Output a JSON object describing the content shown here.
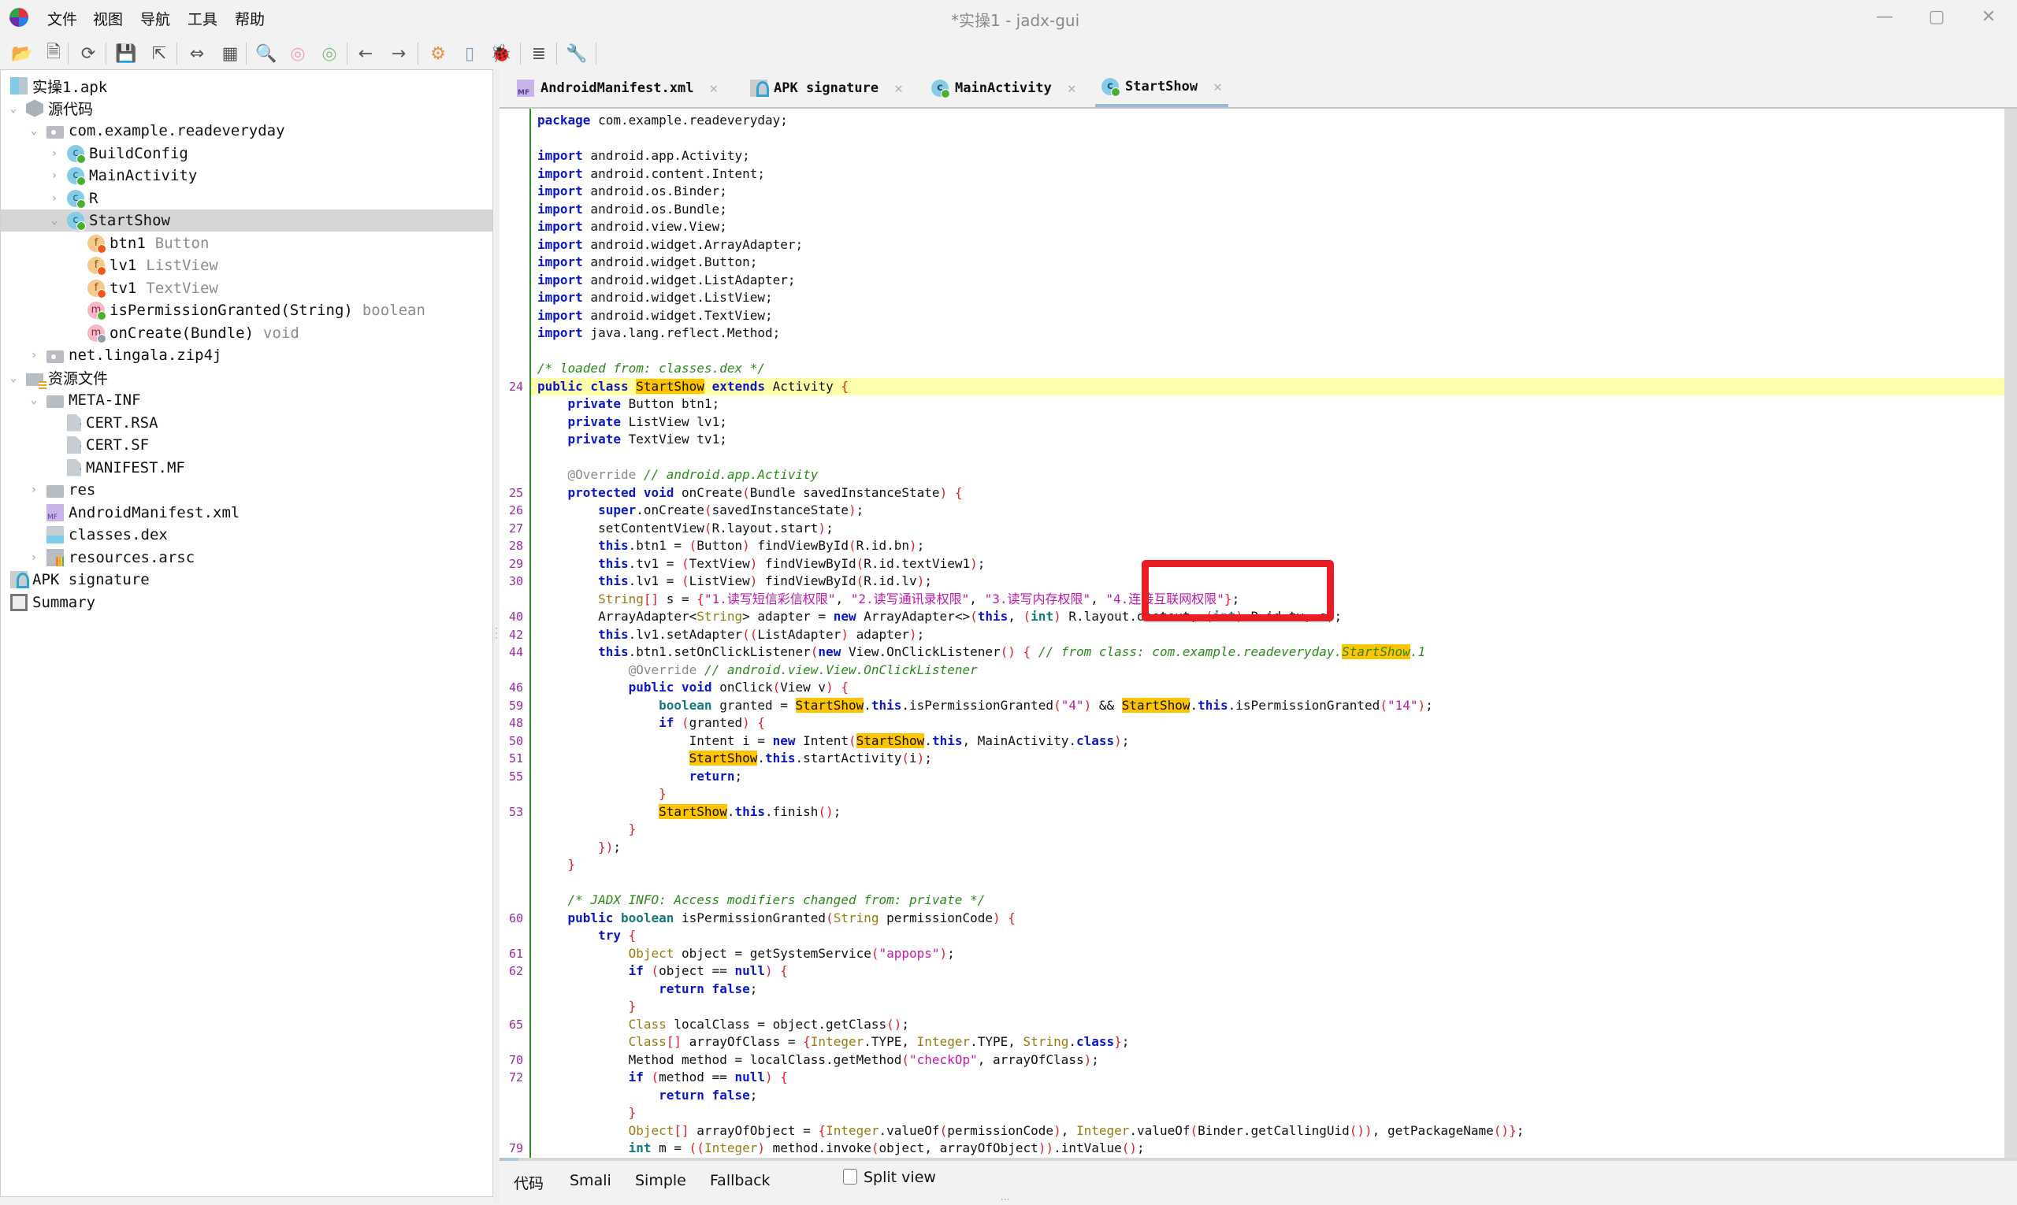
{
  "window": {
    "title": "*实操1 - jadx-gui",
    "controls": {
      "minimize": "—",
      "maximize": "▢",
      "close": "✕"
    }
  },
  "menu": [
    "文件",
    "视图",
    "导航",
    "工具",
    "帮助"
  ],
  "toolbar": {
    "buttons": [
      {
        "name": "open-file",
        "glyph": "📂"
      },
      {
        "name": "add-files",
        "glyph": "🗎"
      },
      {
        "name": "sync",
        "glyph": "⟳"
      },
      {
        "name": "save-all",
        "glyph": "💾"
      },
      {
        "name": "export",
        "glyph": "⇱"
      },
      {
        "name": "flatten-packages",
        "glyph": "⇔"
      },
      {
        "name": "sync-tree",
        "glyph": "▦"
      },
      {
        "name": "search-text",
        "glyph": "🔍"
      },
      {
        "name": "search-class",
        "glyph": "◎"
      },
      {
        "name": "search-usage",
        "glyph": "◎"
      },
      {
        "name": "back",
        "glyph": "←"
      },
      {
        "name": "forward",
        "glyph": "→"
      },
      {
        "name": "deobfuscation",
        "glyph": "⚙"
      },
      {
        "name": "smali-view",
        "glyph": "▯"
      },
      {
        "name": "debugger",
        "glyph": "🐞"
      },
      {
        "name": "log-viewer",
        "glyph": "≣"
      },
      {
        "name": "preferences",
        "glyph": "🔧"
      }
    ]
  },
  "tree": {
    "items": [
      {
        "label": "实操1.apk",
        "icon": "apk",
        "depth": 0,
        "toggle": ""
      },
      {
        "label": "源代码",
        "icon": "cube",
        "depth": 0,
        "toggle": "⌄"
      },
      {
        "label": "com.example.readeveryday",
        "icon": "package",
        "depth": 1,
        "toggle": "⌄"
      },
      {
        "label": "BuildConfig",
        "icon": "class",
        "depth": 2,
        "toggle": "›"
      },
      {
        "label": "MainActivity",
        "icon": "class",
        "depth": 2,
        "toggle": "›"
      },
      {
        "label": "R",
        "icon": "class",
        "depth": 2,
        "toggle": "›"
      },
      {
        "label": "StartShow",
        "icon": "class",
        "depth": 2,
        "toggle": "⌄",
        "selected": true
      },
      {
        "label": "btn1",
        "type": "Button",
        "icon": "field",
        "depth": 3,
        "toggle": ""
      },
      {
        "label": "lv1",
        "type": "ListView",
        "icon": "field",
        "depth": 3,
        "toggle": ""
      },
      {
        "label": "tv1",
        "type": "TextView",
        "icon": "field",
        "depth": 3,
        "toggle": ""
      },
      {
        "label": "isPermissionGranted(String)",
        "type": "boolean",
        "icon": "method",
        "depth": 3,
        "toggle": ""
      },
      {
        "label": "onCreate(Bundle)",
        "type": "void",
        "icon": "method-grey",
        "depth": 3,
        "toggle": ""
      },
      {
        "label": "net.lingala.zip4j",
        "icon": "package",
        "depth": 1,
        "toggle": "›"
      },
      {
        "label": "资源文件",
        "icon": "res",
        "depth": 0,
        "toggle": "⌄"
      },
      {
        "label": "META-INF",
        "icon": "folder",
        "depth": 1,
        "toggle": "⌄"
      },
      {
        "label": "CERT.RSA",
        "icon": "file-q",
        "depth": 2,
        "toggle": ""
      },
      {
        "label": "CERT.SF",
        "icon": "file-q",
        "depth": 2,
        "toggle": ""
      },
      {
        "label": "MANIFEST.MF",
        "icon": "file-q",
        "depth": 2,
        "toggle": ""
      },
      {
        "label": "res",
        "icon": "folder",
        "depth": 1,
        "toggle": "›"
      },
      {
        "label": "AndroidManifest.xml",
        "icon": "mf",
        "depth": 1,
        "toggle": ""
      },
      {
        "label": "classes.dex",
        "icon": "dex",
        "depth": 1,
        "toggle": ""
      },
      {
        "label": "resources.arsc",
        "icon": "arsc",
        "depth": 1,
        "toggle": "›"
      },
      {
        "label": "APK signature",
        "icon": "sig",
        "depth": 0,
        "toggle": ""
      },
      {
        "label": "Summary",
        "icon": "summary",
        "depth": 0,
        "toggle": ""
      }
    ]
  },
  "tabs": [
    {
      "label": "AndroidManifest.xml",
      "icon": "mf",
      "close": "✕"
    },
    {
      "label": "APK signature",
      "icon": "sig",
      "close": "✕"
    },
    {
      "label": "MainActivity",
      "icon": "class",
      "close": "✕"
    },
    {
      "label": "StartShow",
      "icon": "class",
      "close": "✕",
      "active": true
    }
  ],
  "code": {
    "highlighted_line_index": 15,
    "lines": [
      {
        "ln": "",
        "html": "<span class='kw'>package</span> com.example.readeveryday;"
      },
      {
        "ln": "",
        "html": ""
      },
      {
        "ln": "",
        "html": "<span class='kw'>import</span> android.app.Activity;"
      },
      {
        "ln": "",
        "html": "<span class='kw'>import</span> android.content.Intent;"
      },
      {
        "ln": "",
        "html": "<span class='kw'>import</span> android.os.Binder;"
      },
      {
        "ln": "",
        "html": "<span class='kw'>import</span> android.os.Bundle;"
      },
      {
        "ln": "",
        "html": "<span class='kw'>import</span> android.view.View;"
      },
      {
        "ln": "",
        "html": "<span class='kw'>import</span> android.widget.ArrayAdapter;"
      },
      {
        "ln": "",
        "html": "<span class='kw'>import</span> android.widget.Button;"
      },
      {
        "ln": "",
        "html": "<span class='kw'>import</span> android.widget.ListAdapter;"
      },
      {
        "ln": "",
        "html": "<span class='kw'>import</span> android.widget.ListView;"
      },
      {
        "ln": "",
        "html": "<span class='kw'>import</span> android.widget.TextView;"
      },
      {
        "ln": "",
        "html": "<span class='kw'>import</span> java.lang.reflect.Method;"
      },
      {
        "ln": "",
        "html": ""
      },
      {
        "ln": "",
        "html": "<span class='cm'>/* loaded from: classes.dex */</span>"
      },
      {
        "ln": "24",
        "html": "<span class='kw'>public class</span> <span class='mk'>StartShow</span> <span class='kw'>extends</span> Activity <span class='pr'>{</span>"
      },
      {
        "ln": "",
        "html": "    <span class='kw'>private</span> Button btn1;"
      },
      {
        "ln": "",
        "html": "    <span class='kw'>private</span> ListView lv1;"
      },
      {
        "ln": "",
        "html": "    <span class='kw'>private</span> TextView tv1;"
      },
      {
        "ln": "",
        "html": ""
      },
      {
        "ln": "",
        "html": "    <span class='an'>@Override</span> <span class='cm'>// android.app.Activity</span>"
      },
      {
        "ln": "25",
        "html": "    <span class='kw'>protected void</span> onCreate<span class='pr'>(</span>Bundle savedInstanceState<span class='pr'>)</span> <span class='pr'>{</span>"
      },
      {
        "ln": "26",
        "html": "        <span class='kw'>super</span>.onCreate<span class='pr'>(</span>savedInstanceState<span class='pr'>)</span>;"
      },
      {
        "ln": "27",
        "html": "        setContentView<span class='pr'>(</span>R.layout.start<span class='pr'>)</span>;"
      },
      {
        "ln": "28",
        "html": "        <span class='kw'>this</span>.btn1 = <span class='pr'>(</span>Button<span class='pr'>)</span> findViewById<span class='pr'>(</span>R.id.bn<span class='pr'>)</span>;"
      },
      {
        "ln": "29",
        "html": "        <span class='kw'>this</span>.tv1 = <span class='pr'>(</span>TextView<span class='pr'>)</span> findViewById<span class='pr'>(</span>R.id.textView1<span class='pr'>)</span>;"
      },
      {
        "ln": "30",
        "html": "        <span class='kw'>this</span>.lv1 = <span class='pr'>(</span>ListView<span class='pr'>)</span> findViewById<span class='pr'>(</span>R.id.lv<span class='pr'>)</span>;"
      },
      {
        "ln": "",
        "html": "        <span class='ty'>String</span><span class='pr'>[]</span> s = <span class='pr'>{</span><span class='st'>\"1.读写短信彩信权限\"</span>, <span class='st'>\"2.读写通讯录权限\"</span>, <span class='st'>\"3.读写内存权限\"</span>, <span class='st'>\"4.连接互联网权限\"</span><span class='pr'>}</span>;"
      },
      {
        "ln": "40",
        "html": "        ArrayAdapter&lt;<span class='ty'>String</span>&gt; adapter = <span class='kw'>new</span> ArrayAdapter&lt;&gt;<span class='pr'>(</span><span class='kw'>this</span>, <span class='pr'>(</span><span class='kw2'>int</span><span class='pr'>)</span> R.layout.onetext, <span class='pr'>(</span><span class='kw2'>int</span><span class='pr'>)</span> R.id.tv, s<span class='pr'>)</span>;"
      },
      {
        "ln": "42",
        "html": "        <span class='kw'>this</span>.lv1.setAdapter<span class='pr'>((</span>ListAdapter<span class='pr'>)</span> adapter<span class='pr'>)</span>;"
      },
      {
        "ln": "44",
        "html": "        <span class='kw'>this</span>.btn1.setOnClickListener<span class='pr'>(</span><span class='kw'>new</span> View.OnClickListener<span class='pr'>()</span> <span class='pr'>{</span> <span class='cm'>// from class: com.example.readeveryday.<span class='mk'>StartShow</span>.1</span>"
      },
      {
        "ln": "",
        "html": "            <span class='an'>@Override</span> <span class='cm'>// android.view.View.OnClickListener</span>"
      },
      {
        "ln": "46",
        "html": "            <span class='kw'>public void</span> onClick<span class='pr'>(</span>View v<span class='pr'>)</span> <span class='pr'>{</span>"
      },
      {
        "ln": "59",
        "html": "                <span class='kw2'>boolean</span> granted = <span class='mk'>StartShow</span>.<span class='kw'>this</span>.isPermissionGranted<span class='pr'>(</span><span class='st'>\"4\"</span><span class='pr'>)</span> &amp;&amp; <span class='mk'>StartShow</span>.<span class='kw'>this</span>.isPermissionGranted<span class='pr'>(</span><span class='st'>\"14\"</span><span class='pr'>)</span>;"
      },
      {
        "ln": "48",
        "html": "                <span class='kw'>if</span> <span class='pr'>(</span>granted<span class='pr'>)</span> <span class='pr'>{</span>"
      },
      {
        "ln": "50",
        "html": "                    Intent i = <span class='kw'>new</span> Intent<span class='pr'>(</span><span class='mk'>StartShow</span>.<span class='kw'>this</span>, MainActivity.<span class='kw'>class</span><span class='pr'>)</span>;"
      },
      {
        "ln": "51",
        "html": "                    <span class='mk'>StartShow</span>.<span class='kw'>this</span>.startActivity<span class='pr'>(</span>i<span class='pr'>)</span>;"
      },
      {
        "ln": "55",
        "html": "                    <span class='kw'>return</span>;"
      },
      {
        "ln": "",
        "html": "                <span class='pr'>}</span>"
      },
      {
        "ln": "53",
        "html": "                <span class='mk'>StartShow</span>.<span class='kw'>this</span>.finish<span class='pr'>()</span>;"
      },
      {
        "ln": "",
        "html": "            <span class='pr'>}</span>"
      },
      {
        "ln": "",
        "html": "        <span class='pr'>})</span>;"
      },
      {
        "ln": "",
        "html": "    <span class='pr'>}</span>"
      },
      {
        "ln": "",
        "html": ""
      },
      {
        "ln": "",
        "html": "    <span class='cm'>/* JADX INFO: Access modifiers changed from: private */</span>"
      },
      {
        "ln": "60",
        "html": "    <span class='kw'>public</span> <span class='kw2'>boolean</span> isPermissionGranted<span class='pr'>(</span><span class='ty'>String</span> permissionCode<span class='pr'>)</span> <span class='pr'>{</span>"
      },
      {
        "ln": "",
        "html": "        <span class='kw'>try</span> <span class='pr'>{</span>"
      },
      {
        "ln": "61",
        "html": "            <span class='ty'>Object</span> object = getSystemService<span class='pr'>(</span><span class='st'>\"appops\"</span><span class='pr'>)</span>;"
      },
      {
        "ln": "62",
        "html": "            <span class='kw'>if</span> <span class='pr'>(</span>object == <span class='kw'>null</span><span class='pr'>)</span> <span class='pr'>{</span>"
      },
      {
        "ln": "",
        "html": "                <span class='kw'>return false</span>;"
      },
      {
        "ln": "",
        "html": "            <span class='pr'>}</span>"
      },
      {
        "ln": "65",
        "html": "            <span class='ty'>Class</span> localClass = object.getClass<span class='pr'>()</span>;"
      },
      {
        "ln": "",
        "html": "            <span class='ty'>Class</span><span class='pr'>[]</span> arrayOfClass = <span class='pr'>{</span><span class='ty'>Integer</span>.TYPE, <span class='ty'>Integer</span>.TYPE, <span class='ty'>String</span>.<span class='kw'>class</span><span class='pr'>}</span>;"
      },
      {
        "ln": "70",
        "html": "            Method method = localClass.getMethod<span class='pr'>(</span><span class='st'>\"checkOp\"</span>, arrayOfClass<span class='pr'>)</span>;"
      },
      {
        "ln": "72",
        "html": "            <span class='kw'>if</span> <span class='pr'>(</span>method == <span class='kw'>null</span><span class='pr'>)</span> <span class='pr'>{</span>"
      },
      {
        "ln": "",
        "html": "                <span class='kw'>return false</span>;"
      },
      {
        "ln": "",
        "html": "            <span class='pr'>}</span>"
      },
      {
        "ln": "",
        "html": "            <span class='ty'>Object</span><span class='pr'>[]</span> arrayOfObject = <span class='pr'>{</span><span class='ty'>Integer</span>.valueOf<span class='pr'>(</span>permissionCode<span class='pr'>)</span>, <span class='ty'>Integer</span>.valueOf<span class='pr'>(</span>Binder.getCallingUid<span class='pr'>())</span>, getPackageName<span class='pr'>()}</span>;"
      },
      {
        "ln": "79",
        "html": "            <span class='kw2'>int</span> m = <span class='pr'>((</span><span class='ty'>Integer</span><span class='pr'>)</span> method.invoke<span class='pr'>(</span>object, arrayOfObject<span class='pr'>))</span>.intValue<span class='pr'>()</span>;"
      }
    ]
  },
  "bottom_tabs": [
    "代码",
    "Smali",
    "Simple",
    "Fallback"
  ],
  "split_view": {
    "label": "Split view",
    "checked": false
  },
  "annotation": {
    "color": "#ec1c24",
    "target": "\"4.连接互联网权限\""
  }
}
